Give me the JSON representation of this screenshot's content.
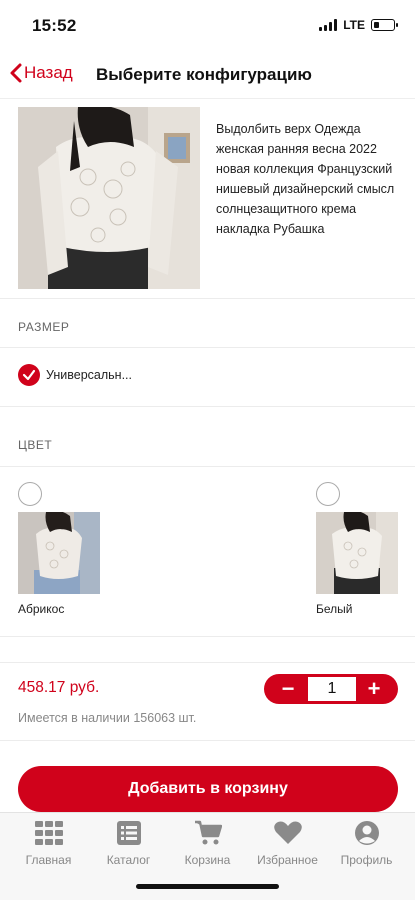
{
  "status_bar": {
    "time": "15:52",
    "network": "LTE",
    "battery_level_pct": 30
  },
  "nav": {
    "back_label": "Назад",
    "title": "Выберите конфигурацию"
  },
  "product": {
    "description": "Выдолбить верх Одежда женская ранняя весна 2022 новая коллекция Французский нишевый дизайнерский смысл солнцезащитного крема накладка Рубашка"
  },
  "size": {
    "section_label": "РАЗМЕР",
    "options": [
      {
        "label": "Универсальн...",
        "selected": true
      }
    ]
  },
  "color": {
    "section_label": "ЦВЕТ",
    "options": [
      {
        "label": "Абрикос",
        "selected": false
      },
      {
        "label": "Белый",
        "selected": false
      }
    ]
  },
  "purchase": {
    "price": "458.17 руб.",
    "stock": "Имеется в наличии 156063 шт.",
    "quantity": "1",
    "minus_label": "−",
    "plus_label": "+",
    "add_to_cart_label": "Добавить в корзину"
  },
  "tabs": [
    {
      "label": "Главная",
      "icon": "grid-icon"
    },
    {
      "label": "Каталог",
      "icon": "catalog-list-icon"
    },
    {
      "label": "Корзина",
      "icon": "cart-icon"
    },
    {
      "label": "Избранное",
      "icon": "heart-icon"
    },
    {
      "label": "Профиль",
      "icon": "profile-icon"
    }
  ],
  "colors": {
    "accent": "#d0021b",
    "tab_icon": "#8a8a8a",
    "text_muted": "#888888"
  }
}
